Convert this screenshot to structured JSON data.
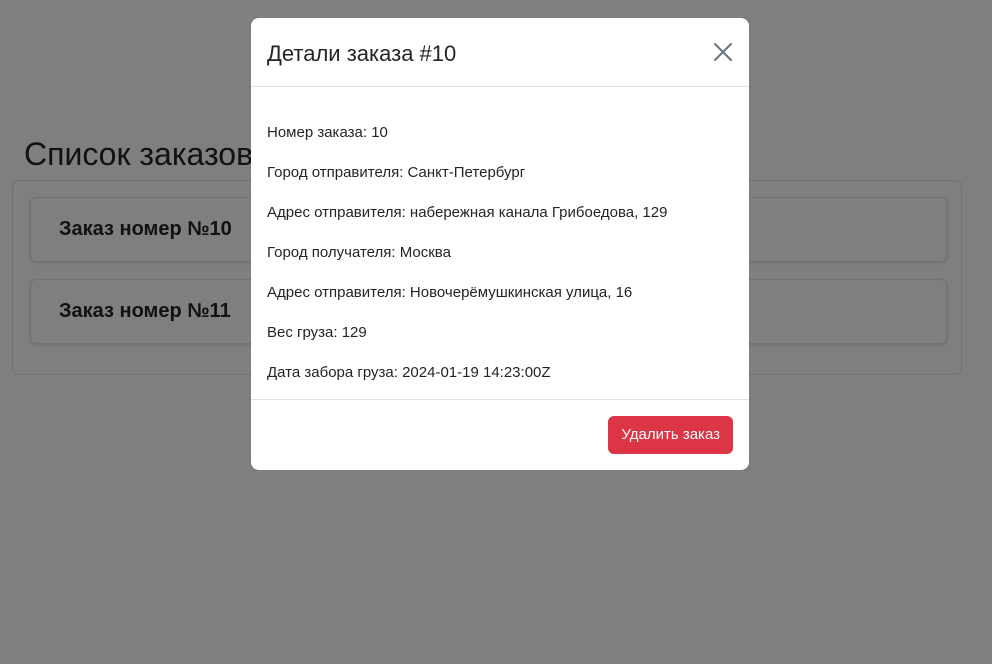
{
  "page": {
    "title": "Список заказов",
    "orders": [
      {
        "label": "Заказ номер №10"
      },
      {
        "label": "Заказ номер №11"
      }
    ]
  },
  "modal": {
    "title": "Детали заказа #10",
    "close_icon": "close-x-icon",
    "details": [
      {
        "label": "Номер заказа:",
        "value": "10"
      },
      {
        "label": "Город отправителя:",
        "value": "Санкт-Петербург"
      },
      {
        "label": "Адрес отправителя:",
        "value": "набережная канала Грибоедова, 129"
      },
      {
        "label": "Город получателя:",
        "value": "Москва"
      },
      {
        "label": "Адрес отправителя:",
        "value": "Новочерёмушкинская улица, 16"
      },
      {
        "label": "Вес груза:",
        "value": "129"
      },
      {
        "label": "Дата забора груза:",
        "value": "2024-01-19 14:23:00Z"
      }
    ],
    "delete_label": "Удалить заказ"
  },
  "colors": {
    "danger": "#dc3545",
    "backdrop": "rgba(0,0,0,0.5)",
    "border": "#dee2e6",
    "text": "#212529"
  }
}
